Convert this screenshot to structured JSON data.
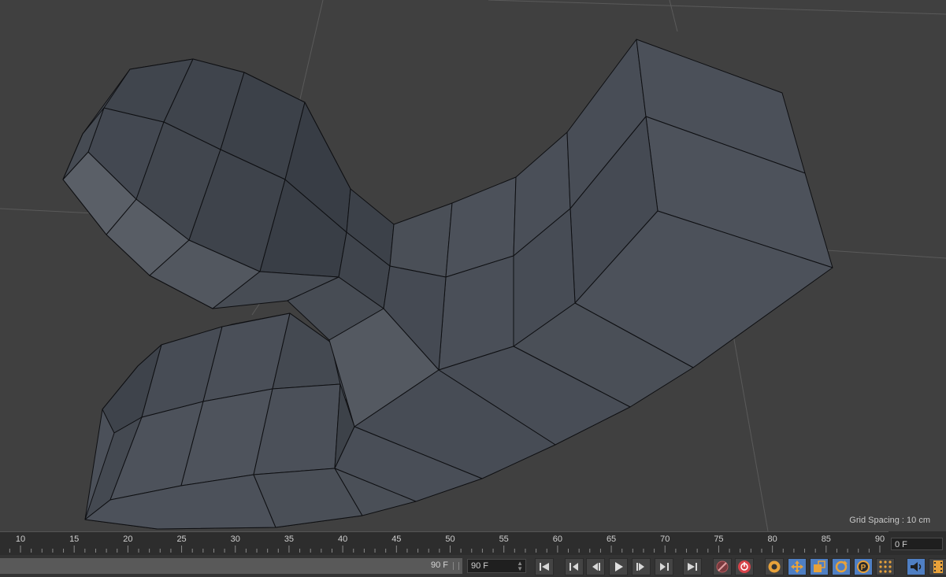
{
  "viewport": {
    "grid_spacing_label": "Grid Spacing : 10 cm"
  },
  "timeline": {
    "ticks": [
      "10",
      "15",
      "20",
      "25",
      "30",
      "35",
      "40",
      "45",
      "50",
      "55",
      "60",
      "65",
      "70",
      "75",
      "80",
      "85",
      "90"
    ],
    "current_frame": "0 F"
  },
  "transport": {
    "range_end_label": "90 F",
    "end_frame_value": "90 F"
  },
  "colors": {
    "viewport_bg": "#404040",
    "mesh_face": "#4a4f57",
    "accent_orange": "#e8a23a",
    "accent_blue": "#4f7fc3",
    "record_red": "#d8434a"
  },
  "icons": [
    "go-to-start-icon",
    "prev-key-icon",
    "prev-frame-icon",
    "play-icon",
    "next-frame-icon",
    "next-key-icon",
    "go-to-end-icon",
    "autokey-icon",
    "record-icon",
    "keyframe-selection-icon",
    "move-icon",
    "scale-icon",
    "rotate-icon",
    "parameter-icon",
    "point-level-icon",
    "sound-icon",
    "film-icon"
  ]
}
